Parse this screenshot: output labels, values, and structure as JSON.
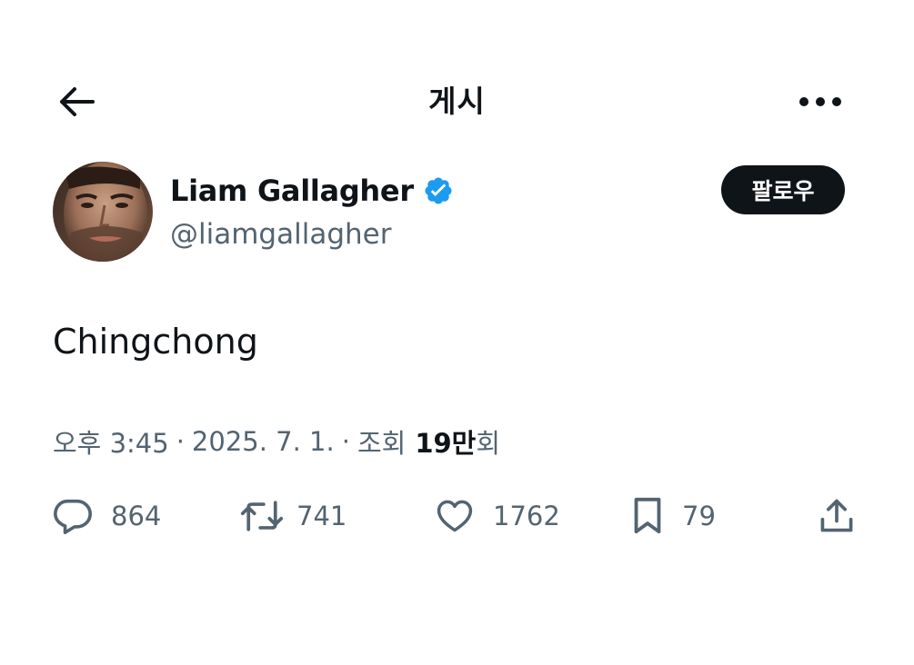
{
  "header": {
    "title": "게시"
  },
  "author": {
    "name": "Liam Gallagher",
    "handle": "@liamgallagher",
    "verified": true,
    "badge_color": "#1d9bf0"
  },
  "follow_button": {
    "label": "팔로우"
  },
  "post": {
    "text": "Chingchong"
  },
  "meta": {
    "time": "오후 3:45",
    "separator": "·",
    "date": "2025. 7. 1.",
    "views_prefix": "조회",
    "views_count": "19만",
    "views_suffix": "회"
  },
  "actions": {
    "reply": {
      "icon": "reply-icon",
      "count": "864"
    },
    "retweet": {
      "icon": "retweet-icon",
      "count": "741"
    },
    "like": {
      "icon": "heart-icon",
      "count": "1762"
    },
    "bookmark": {
      "icon": "bookmark-icon",
      "count": "79"
    },
    "share": {
      "icon": "share-icon"
    }
  },
  "colors": {
    "text_primary": "#0f1419",
    "text_secondary": "#536471",
    "accent": "#1d9bf0",
    "button_bg": "#0f1419"
  }
}
